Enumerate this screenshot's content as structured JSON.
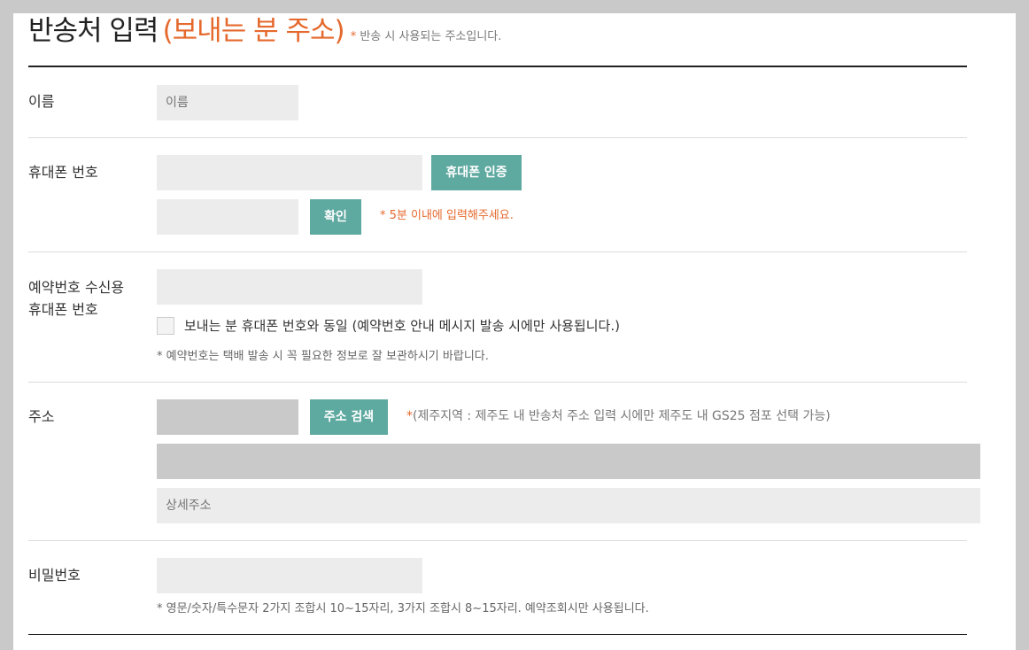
{
  "header": {
    "title": "반송처 입력",
    "subtitle": "(보내는 분 주소)",
    "note_star": "*",
    "note": "반송 시 사용되는 주소입니다."
  },
  "name": {
    "label": "이름",
    "placeholder": "이름"
  },
  "phone": {
    "label": "휴대폰 번호",
    "verify_button": "휴대폰 인증",
    "confirm_button": "확인",
    "timer_note": "* 5분 이내에 입력해주세요."
  },
  "reservation_phone": {
    "label_line1": "예약번호 수신용",
    "label_line2": "휴대폰 번호",
    "same_as_sender": "보내는 분 휴대폰 번호와 동일 (예약번호 안내 메시지 발송 시에만 사용됩니다.)",
    "same_as_sender_checked": false,
    "note": "* 예약번호는 택배 발송 시 꼭 필요한 정보로 잘 보관하시기 바랍니다."
  },
  "address": {
    "label": "주소",
    "search_button": "주소 검색",
    "note_star": "*",
    "note": "(제주지역 : 제주도 내 반송처 주소 입력 시에만 제주도 내 GS25 점포 선택 가능)",
    "detail_placeholder": "상세주소"
  },
  "password": {
    "label": "비밀번호",
    "note": "* 영문/숫자/특수문자 2가지 조합시 10~15자리, 3가지 조합시 8~15자리. 예약조회시만 사용됩니다."
  },
  "colors": {
    "accent": "#e5692d",
    "button": "#5ea9a0",
    "input_bg": "#ececec",
    "disabled_bg": "#c9c9c9"
  }
}
